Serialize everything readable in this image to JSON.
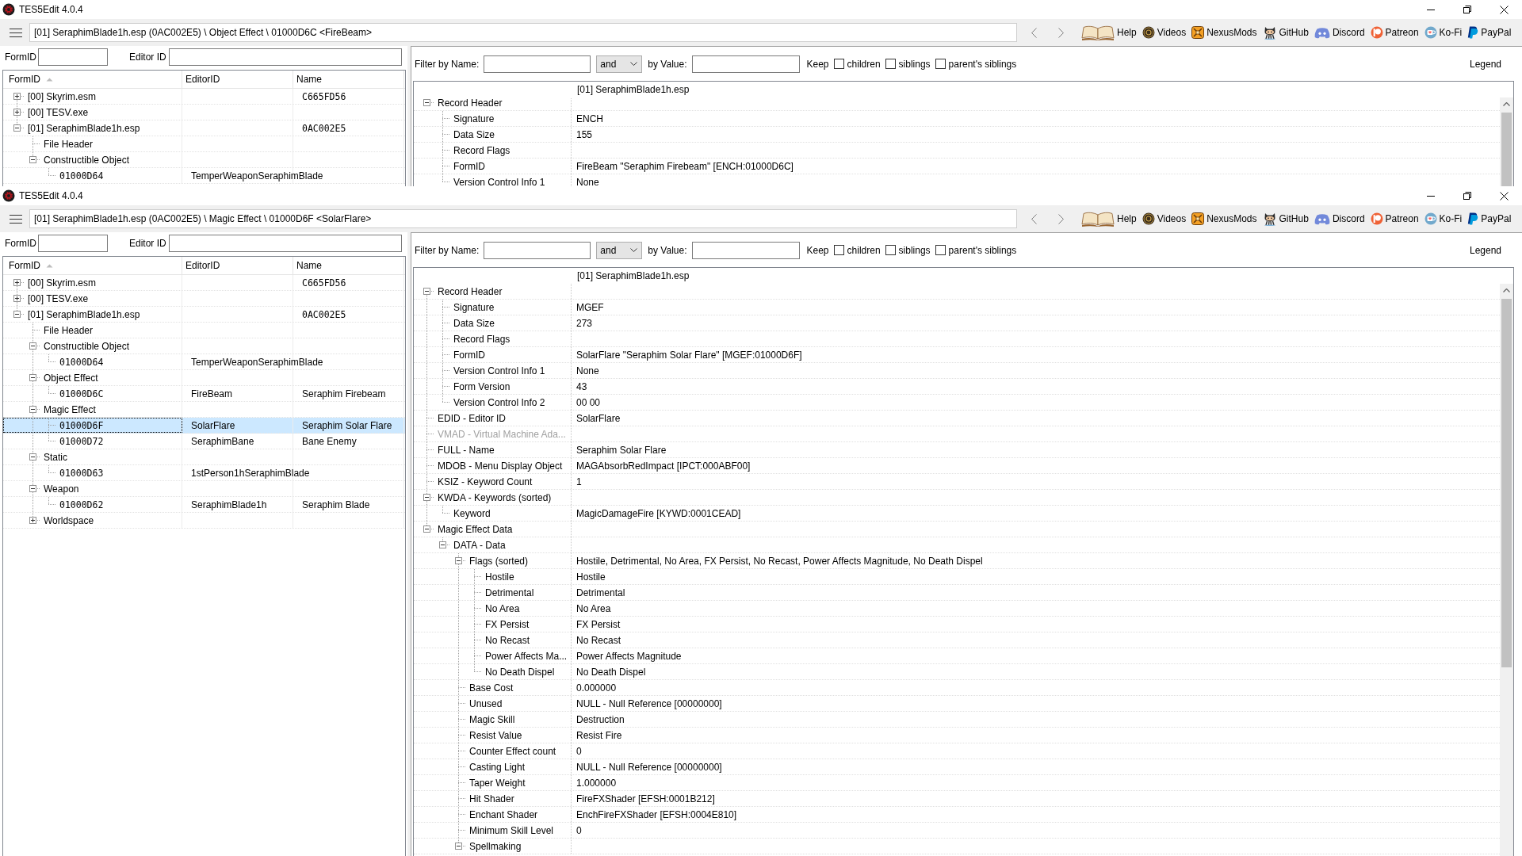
{
  "windows": [
    {
      "title": "TES5Edit 4.0.4",
      "path": "[01] SeraphimBlade1h.esp (0AC002E5) \\ Object Effect \\ 01000D6C <FireBeam>",
      "links": [
        "Help",
        "Videos",
        "NexusMods",
        "GitHub",
        "Discord",
        "Patreon",
        "Ko-Fi",
        "PayPal"
      ],
      "search": {
        "formid_label": "FormID",
        "editorid_label": "Editor ID"
      },
      "navigator": {
        "columns": [
          {
            "label": "FormID",
            "sorted": true
          },
          {
            "label": "EditorID",
            "sorted": false
          },
          {
            "label": "Name",
            "sorted": false
          }
        ],
        "rows": [
          {
            "form_id": "[00] Skyrim.esm",
            "name": "C665FD56",
            "expanded": false,
            "selected": false
          },
          {
            "form_id": "[00] TESV.exe",
            "expanded": false,
            "selected": false
          },
          {
            "form_id": "[01] SeraphimBlade1h.esp",
            "name": "0AC002E5",
            "expanded": true,
            "selected": false,
            "children": [
              {
                "form_id": "File Header",
                "selected": false
              },
              {
                "form_id": "Constructible Object",
                "expanded": true,
                "selected": false,
                "children": [
                  {
                    "form_id": "01000D64",
                    "editor_id": "TemperWeaponSeraphimBlade",
                    "selected": false
                  }
                ]
              }
            ]
          }
        ]
      },
      "filter": {
        "name_label": "Filter by Name:",
        "operator": "and",
        "value_label": "by Value:",
        "keep_label": "Keep",
        "options": [
          {
            "label": "children",
            "checked": false
          },
          {
            "label": "siblings",
            "checked": false
          },
          {
            "label": "parent's siblings",
            "checked": false
          }
        ],
        "legend": "Legend"
      },
      "record": {
        "file": "[01] SeraphimBlade1h.esp",
        "fields": [
          {
            "label": "Record Header",
            "expanded": true,
            "disabled": false,
            "children": [
              {
                "label": "Signature",
                "value": "ENCH"
              },
              {
                "label": "Data Size",
                "value": "155"
              },
              {
                "label": "Record Flags"
              },
              {
                "label": "FormID",
                "value": "FireBeam \"Seraphim Firebeam\" [ENCH:01000D6C]"
              },
              {
                "label": "Version Control Info 1",
                "value": "None"
              }
            ]
          }
        ]
      }
    },
    {
      "title": "TES5Edit 4.0.4",
      "path": "[01] SeraphimBlade1h.esp (0AC002E5) \\ Magic Effect \\ 01000D6F <SolarFlare>",
      "links": [
        "Help",
        "Videos",
        "NexusMods",
        "GitHub",
        "Discord",
        "Patreon",
        "Ko-Fi",
        "PayPal"
      ],
      "search": {
        "formid_label": "FormID",
        "editorid_label": "Editor ID"
      },
      "navigator": {
        "columns": [
          {
            "label": "FormID",
            "sorted": true
          },
          {
            "label": "EditorID",
            "sorted": false
          },
          {
            "label": "Name",
            "sorted": false
          }
        ],
        "rows": [
          {
            "form_id": "[00] Skyrim.esm",
            "name": "C665FD56",
            "expanded": false,
            "selected": false
          },
          {
            "form_id": "[00] TESV.exe",
            "expanded": false,
            "selected": false
          },
          {
            "form_id": "[01] SeraphimBlade1h.esp",
            "name": "0AC002E5",
            "expanded": true,
            "selected": false,
            "children": [
              {
                "form_id": "File Header",
                "selected": false
              },
              {
                "form_id": "Constructible Object",
                "expanded": true,
                "selected": false,
                "children": [
                  {
                    "form_id": "01000D64",
                    "editor_id": "TemperWeaponSeraphimBlade",
                    "selected": false
                  }
                ]
              },
              {
                "form_id": "Object Effect",
                "expanded": true,
                "selected": false,
                "children": [
                  {
                    "form_id": "01000D6C",
                    "editor_id": "FireBeam",
                    "name": "Seraphim Firebeam",
                    "selected": false
                  }
                ]
              },
              {
                "form_id": "Magic Effect",
                "expanded": true,
                "selected": false,
                "children": [
                  {
                    "form_id": "01000D6F",
                    "editor_id": "SolarFlare",
                    "name": "Seraphim Solar Flare",
                    "selected": true
                  },
                  {
                    "form_id": "01000D72",
                    "editor_id": "SeraphimBane",
                    "name": "Bane Enemy",
                    "selected": false
                  }
                ]
              },
              {
                "form_id": "Static",
                "expanded": true,
                "selected": false,
                "children": [
                  {
                    "form_id": "01000D63",
                    "editor_id": "1stPerson1hSeraphimBlade",
                    "selected": false
                  }
                ]
              },
              {
                "form_id": "Weapon",
                "expanded": true,
                "selected": false,
                "children": [
                  {
                    "form_id": "01000D62",
                    "editor_id": "SeraphimBlade1h",
                    "name": "Seraphim Blade",
                    "selected": false
                  }
                ]
              },
              {
                "form_id": "Worldspace",
                "expanded": false,
                "selected": false
              }
            ]
          }
        ]
      },
      "filter": {
        "name_label": "Filter by Name:",
        "operator": "and",
        "value_label": "by Value:",
        "keep_label": "Keep",
        "options": [
          {
            "label": "children",
            "checked": false
          },
          {
            "label": "siblings",
            "checked": false
          },
          {
            "label": "parent's siblings",
            "checked": false
          }
        ],
        "legend": "Legend"
      },
      "record": {
        "file": "[01] SeraphimBlade1h.esp",
        "fields": [
          {
            "label": "Record Header",
            "expanded": true,
            "disabled": false,
            "children": [
              {
                "label": "Signature",
                "value": "MGEF"
              },
              {
                "label": "Data Size",
                "value": "273"
              },
              {
                "label": "Record Flags"
              },
              {
                "label": "FormID",
                "value": "SolarFlare \"Seraphim Solar Flare\" [MGEF:01000D6F]"
              },
              {
                "label": "Version Control Info 1",
                "value": "None"
              },
              {
                "label": "Form Version",
                "value": "43"
              },
              {
                "label": "Version Control Info 2",
                "value": "00 00"
              }
            ]
          },
          {
            "label": "EDID - Editor ID",
            "value": "SolarFlare",
            "disabled": false
          },
          {
            "label": "VMAD - Virtual Machine Ada...",
            "disabled": true
          },
          {
            "label": "FULL - Name",
            "value": "Seraphim Solar Flare",
            "disabled": false
          },
          {
            "label": "MDOB - Menu Display Object",
            "value": "MAGAbsorbRedImpact [IPCT:000ABF00]",
            "disabled": false
          },
          {
            "label": "KSIZ - Keyword Count",
            "value": "1",
            "disabled": false
          },
          {
            "label": "KWDA - Keywords (sorted)",
            "expanded": true,
            "disabled": false,
            "children": [
              {
                "label": "Keyword",
                "value": "MagicDamageFire [KYWD:0001CEAD]"
              }
            ]
          },
          {
            "label": "Magic Effect Data",
            "expanded": true,
            "disabled": false,
            "children": [
              {
                "label": "DATA - Data",
                "expanded": true,
                "children": [
                  {
                    "label": "Flags (sorted)",
                    "value": "Hostile, Detrimental, No Area, FX Persist, No Recast, Power Affects Magnitude, No Death Dispel",
                    "expanded": true,
                    "children": [
                      {
                        "label": "Hostile",
                        "value": "Hostile"
                      },
                      {
                        "label": "Detrimental",
                        "value": "Detrimental"
                      },
                      {
                        "label": "No Area",
                        "value": "No Area"
                      },
                      {
                        "label": "FX Persist",
                        "value": "FX Persist"
                      },
                      {
                        "label": "No Recast",
                        "value": "No Recast"
                      },
                      {
                        "label": "Power Affects Ma...",
                        "value": "Power Affects Magnitude"
                      },
                      {
                        "label": "No Death Dispel",
                        "value": "No Death Dispel"
                      }
                    ]
                  },
                  {
                    "label": "Base Cost",
                    "value": "0.000000"
                  },
                  {
                    "label": "Unused",
                    "value": "NULL - Null Reference [00000000]"
                  },
                  {
                    "label": "Magic Skill",
                    "value": "Destruction"
                  },
                  {
                    "label": "Resist Value",
                    "value": "Resist Fire"
                  },
                  {
                    "label": "Counter Effect count",
                    "value": "0"
                  },
                  {
                    "label": "Casting Light",
                    "value": "NULL - Null Reference [00000000]"
                  },
                  {
                    "label": "Taper Weight",
                    "value": "1.000000"
                  },
                  {
                    "label": "Hit Shader",
                    "value": "FireFXShader [EFSH:0001B212]"
                  },
                  {
                    "label": "Enchant Shader",
                    "value": "EnchFireFXShader [EFSH:0004E810]"
                  },
                  {
                    "label": "Minimum Skill Level",
                    "value": "0"
                  },
                  {
                    "label": "Spellmaking",
                    "expanded": true
                  }
                ]
              }
            ]
          }
        ]
      }
    }
  ]
}
